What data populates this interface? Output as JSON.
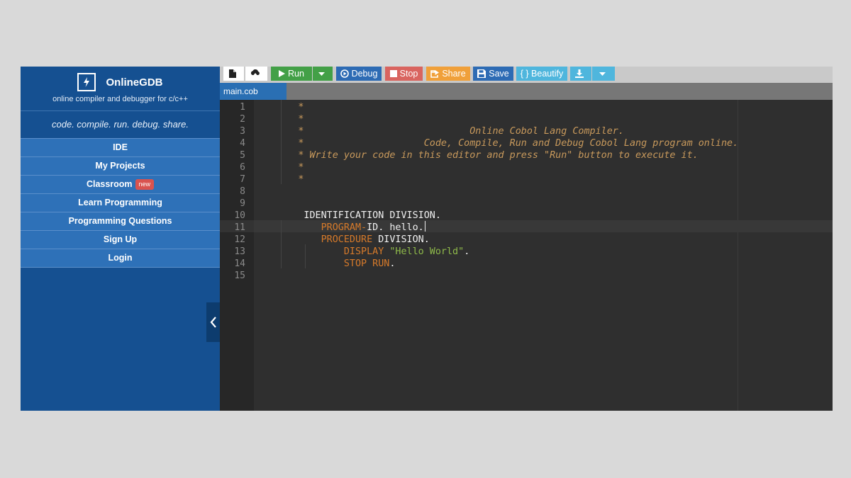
{
  "brand": {
    "name": "OnlineGDB",
    "subtitle": "online compiler and debugger for c/c++",
    "tagline": "code. compile. run. debug. share."
  },
  "nav": [
    {
      "label": "IDE"
    },
    {
      "label": "My Projects"
    },
    {
      "label": "Classroom",
      "badge": "new"
    },
    {
      "label": "Learn Programming"
    },
    {
      "label": "Programming Questions"
    },
    {
      "label": "Sign Up"
    },
    {
      "label": "Login"
    }
  ],
  "toolbar": {
    "run": "Run",
    "debug": "Debug",
    "stop": "Stop",
    "share": "Share",
    "save": "Save",
    "beautify": "{ } Beautify"
  },
  "file_tab": "main.cob",
  "editor": {
    "line_numbers": [
      "1",
      "2",
      "3",
      "4",
      "5",
      "6",
      "7",
      "8",
      "9",
      "10",
      "11",
      "12",
      "13",
      "14",
      "15"
    ],
    "comment_lines": [
      "      *",
      "      *",
      "      *                             Online Cobol Lang Compiler.",
      "      *                     Code, Compile, Run and Debug Cobol Lang program online.",
      "      * Write your code in this editor and press \"Run\" button to execute it.",
      "      *",
      "      *"
    ],
    "line10": {
      "text": "IDENTIFICATION DIVISION."
    },
    "line11": {
      "kw": "PROGRAM-",
      "rest": "ID. hello."
    },
    "line12": {
      "kw": "PROCEDURE",
      "rest": " DIVISION."
    },
    "line13": {
      "kw": "DISPLAY",
      "str": "\"Hello World\"",
      "end": "."
    },
    "line14": {
      "kw": "STOP RUN",
      "end": "."
    }
  },
  "colors": {
    "sidebar": "#155091",
    "nav_item": "#2e71b8",
    "run": "#43a047",
    "debug": "#2d6bb4",
    "stop": "#d9645f",
    "share": "#f0a03a",
    "save": "#2d6bb4",
    "beautify": "#4fb6dd"
  }
}
